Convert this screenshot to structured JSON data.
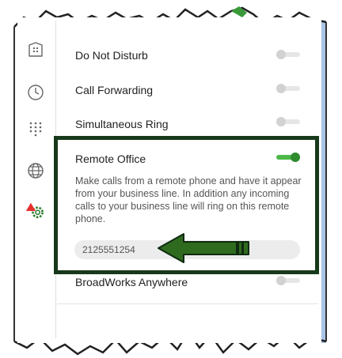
{
  "settings": {
    "items": [
      {
        "label": "Do Not Disturb",
        "enabled": false
      },
      {
        "label": "Call Forwarding",
        "enabled": false
      },
      {
        "label": "Simultaneous Ring",
        "enabled": false
      },
      {
        "label": "Remote Office",
        "enabled": true
      },
      {
        "label": "BroadWorks Anywhere",
        "enabled": false
      }
    ],
    "remote_office": {
      "description": "Make calls from a remote phone and have it appear from your business line. In addition any incoming calls to your business line will ring on this remote phone.",
      "phone_value": "2125551254"
    }
  },
  "sidebar": {
    "icons": [
      "building-icon",
      "clock-icon",
      "dialpad-icon",
      "globe-icon",
      "settings-gear-alert-icon"
    ]
  },
  "colors": {
    "accent_green": "#4db848",
    "highlight_border": "#17391b",
    "arrow_fill": "#2f6b1f",
    "alert_red": "#e63030",
    "frame_blue": "#a9c4e6"
  }
}
